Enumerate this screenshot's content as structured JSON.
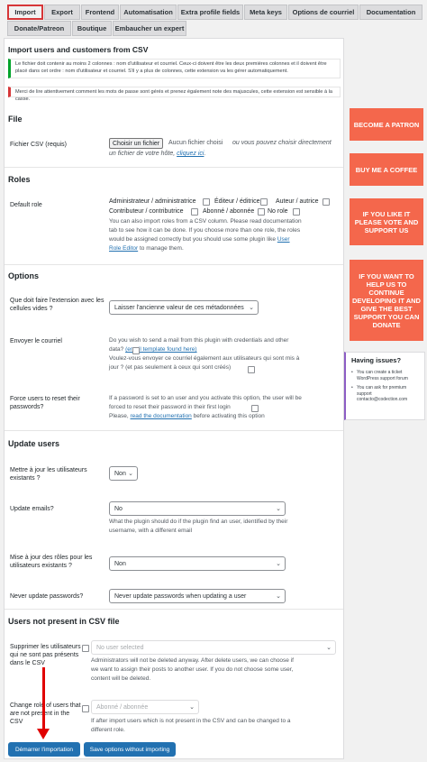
{
  "tabs": {
    "import": "Import",
    "export": "Export",
    "frontend": "Frontend",
    "automatisation": "Automatisation",
    "extra_profile_fields": "Extra profile fields",
    "meta_keys": "Meta keys",
    "options_courriel": "Options de courriel",
    "documentation": "Documentation",
    "donate_patreon": "Donate/Patreon",
    "boutique": "Boutique",
    "embaucher": "Embaucher un expert"
  },
  "page": {
    "title": "Import users and customers from CSV",
    "notice_green": "Le fichier doit contenir au moins 2 colonnes : nom d'utilisateur et courriel. Ceux-ci doivent être les deux premières colonnes et il doivent être placé dans cet ordre : nom d'utilisateur et courriel. S'il y a plus de colonnes, cette extension va les gérer automatiquement.",
    "notice_red": "Merci de lire attentivement comment les mots de passe sont gérés et prenez également note des majuscules, cette extension est sensible à la casse."
  },
  "file": {
    "heading": "File",
    "label": "Fichier CSV (requis)",
    "choose_button": "Choisir un fichier",
    "no_file": "Aucun fichier choisi",
    "alt_text": "ou vous pouvez choisir directement",
    "alt_text2": "un fichier de votre hôte,",
    "alt_link": "cliquez ici",
    "alt_end": "."
  },
  "roles": {
    "heading": "Roles",
    "label": "Default role",
    "options": [
      "Administrateur / administratrice",
      "Éditeur / éditrice",
      "Auteur / autrice",
      "Contributeur / contributrice",
      "Abonné / abonnée",
      "No role"
    ],
    "desc_line1": "You can also import roles from a CSV column. Please read documentation",
    "desc_line2": "tab to see how it can be done. If you choose more than one role, the roles",
    "desc_line3": "would be assigned correctly but you should use some plugin like",
    "desc_link1": "User",
    "desc_link2": "Role Editor",
    "desc_end": "to manage them."
  },
  "options": {
    "heading": "Options",
    "empty_label": "Que doit faire l'extension avec les cellules vides ?",
    "empty_value": "Laisser l'ancienne valeur de ces métadonnées",
    "mail_label": "Envoyer le courriel",
    "mail_desc1": "Do you wish to send a mail from this plugin with credentials and other",
    "mail_desc2": "data?",
    "mail_link": "(email template found here)",
    "mail_desc3": "Voulez-vous envoyer ce courriel également aux utilisateurs qui sont mis à",
    "mail_desc4": "jour ? (et pas seulement à ceux qui sont créés)",
    "reset_label": "Force users to reset their passwords?",
    "reset_desc1": "If a password is set to an user and you activate this option, the user will be",
    "reset_desc2": "forced to reset their password in their first login",
    "reset_desc3": "Please,",
    "reset_link": "read the documentation",
    "reset_desc4": "before activating this option"
  },
  "update": {
    "heading": "Update users",
    "update_label": "Mettre à jour les utilisateurs existants ?",
    "update_value": "Non",
    "emails_label": "Update emails?",
    "emails_value": "No",
    "emails_desc1": "What the plugin should do if the plugin find an user, identified by their",
    "emails_desc2": "username, with a different email",
    "roles_label": "Mise à jour des rôles pour les utilisateurs existants ?",
    "roles_value": "Non",
    "never_label": "Never update passwords?",
    "never_value": "Never update passwords when updating a user"
  },
  "not_present": {
    "heading": "Users not present in CSV file",
    "delete_label": "Supprimer les utilisateurs qui ne sont pas présents dans le CSV",
    "delete_value": "No user selected",
    "delete_desc1": "Administrators will not be deleted anyway. After delete users, we can choose if",
    "delete_desc2": "we want to assign their posts to another user. If you do not choose some user,",
    "delete_desc3": "content will be deleted.",
    "change_label": "Change role of users that are not present in the CSV",
    "change_value": "Abonné / abonnée",
    "change_desc1": "If after import users which is not present in the CSV and can be changed to a",
    "change_desc2": "different role."
  },
  "buttons": {
    "start": "Démarrer l'importation",
    "save": "Save options without importing"
  },
  "promos": {
    "patron": "BECOME A PATRON",
    "coffee": "BUY ME A COFFEE",
    "vote": "IF YOU LIKE IT PLEASE VOTE AND SUPPORT US",
    "donate": "IF YOU WANT TO HELP US TO CONTINUE DEVELOPING IT AND GIVE THE BEST SUPPORT YOU CAN DONATE"
  },
  "issues": {
    "title": "Having issues?",
    "item1": "You can create a ticket WordPress support forum",
    "item2": "You can ask for premium support contacto@codection.com"
  },
  "colors": {
    "accent": "#2271b1",
    "promo": "#f4674c",
    "highlight": "#e00000"
  }
}
